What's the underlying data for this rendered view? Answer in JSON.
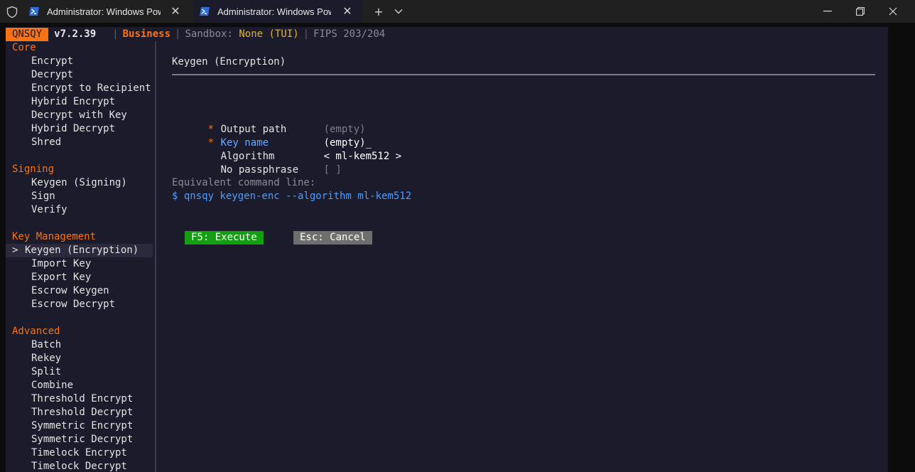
{
  "window": {
    "tabs": [
      {
        "title": "Administrator: Windows PowerShell",
        "active": false
      },
      {
        "title": "Administrator: Windows PowerShell",
        "active": true
      }
    ],
    "new_tab_symbol": "+",
    "dropdown_symbol": "⌄",
    "minimize_symbol": "—",
    "restore_symbol": "❐",
    "close_symbol": "✕",
    "tab_close_symbol": "✕"
  },
  "status": {
    "app": "QNSQY",
    "version": "v7.2.39",
    "separator": "|",
    "edition": "Business",
    "sandbox_label": "Sandbox:",
    "sandbox_value": "None (TUI)",
    "fips": "FIPS 203/204"
  },
  "sidebar": {
    "selection_marker": ">",
    "sections": [
      {
        "title": "Core",
        "items": [
          "Encrypt",
          "Decrypt",
          "Encrypt to Recipient",
          "Hybrid Encrypt",
          "Decrypt with Key",
          "Hybrid Decrypt",
          "Shred"
        ]
      },
      {
        "title": "Signing",
        "items": [
          "Keygen (Signing)",
          "Sign",
          "Verify"
        ]
      },
      {
        "title": "Key Management",
        "items": [
          "Keygen (Encryption)",
          "Import Key",
          "Export Key",
          "Escrow Keygen",
          "Escrow Decrypt"
        ]
      },
      {
        "title": "Advanced",
        "items": [
          "Batch",
          "Rekey",
          "Split",
          "Combine",
          "Threshold Encrypt",
          "Threshold Decrypt",
          "Symmetric Encrypt",
          "Symmetric Decrypt",
          "Timelock Encrypt",
          "Timelock Decrypt"
        ]
      }
    ],
    "selected": "Keygen (Encryption)"
  },
  "form": {
    "title": "Keygen (Encryption)",
    "required_marker": "*",
    "fields": [
      {
        "label": "Output path",
        "value": "(empty)",
        "required": true
      },
      {
        "label": "Key name",
        "value": "(empty)_",
        "required": true,
        "focused": true
      },
      {
        "label": "Algorithm",
        "value": "< ml-kem512 >",
        "required": false
      },
      {
        "label": "No passphrase",
        "value": "[ ]",
        "required": false
      }
    ],
    "command_label": "Equivalent command line:",
    "command": "$ qnsqy keygen-enc --algorithm ml-kem512",
    "execute_label": "F5: Execute",
    "cancel_label": "Esc: Cancel"
  },
  "colors": {
    "accent": "#f97316",
    "background": "#1b1b2b",
    "focus": "#6ea8fe",
    "command": "#4a9eff",
    "execute": "#12a012",
    "cancel": "#6e6e6e"
  }
}
